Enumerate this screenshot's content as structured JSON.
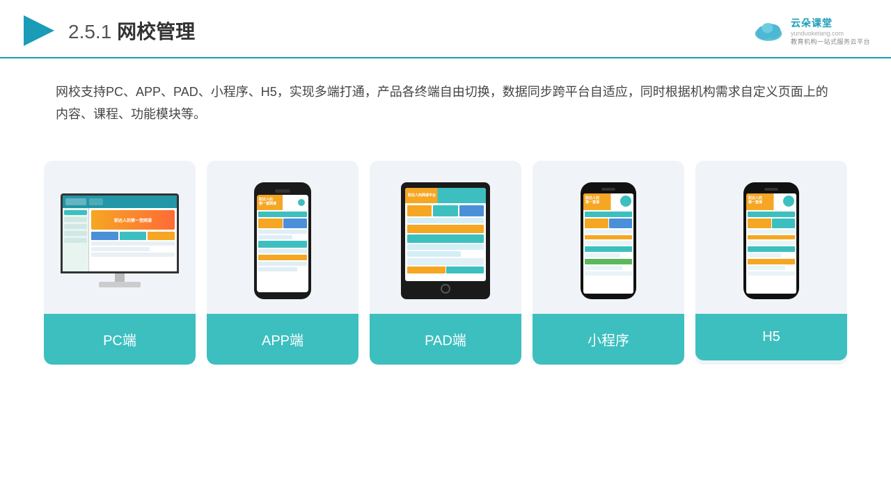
{
  "header": {
    "title": "网校管理",
    "section_number": "2.5.1",
    "logo_name": "云朵课堂",
    "logo_domain": "yunduoketang.com",
    "logo_tagline": "教育机构一站式服务云平台"
  },
  "description": {
    "text": "网校支持PC、APP、PAD、小程序、H5，实现多端打通，产品各终端自由切换，数据同步跨平台自适应，同时根据机构需求自定义页面上的内容、课程、功能模块等。"
  },
  "cards": [
    {
      "id": "pc",
      "label": "PC端"
    },
    {
      "id": "app",
      "label": "APP端"
    },
    {
      "id": "pad",
      "label": "PAD端"
    },
    {
      "id": "miniprogram",
      "label": "小程序"
    },
    {
      "id": "h5",
      "label": "H5"
    }
  ],
  "colors": {
    "teal": "#3dbfc0",
    "accent_blue": "#1a9cb8",
    "border_bottom": "#1a9cb8"
  }
}
